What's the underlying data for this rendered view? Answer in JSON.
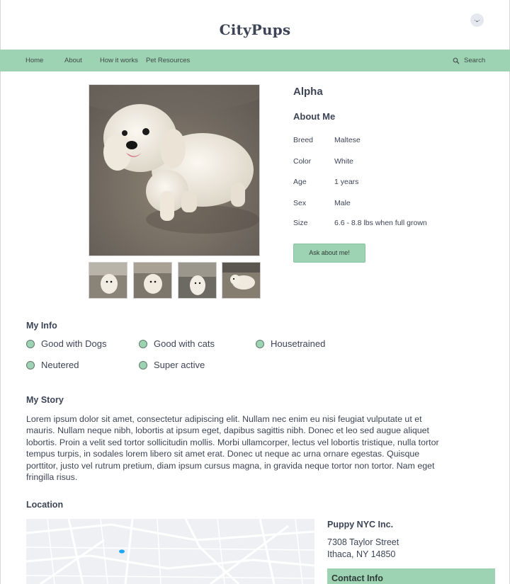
{
  "header": {
    "logo": "CityPups",
    "avatar_face": "·ᴗ·"
  },
  "nav": {
    "items": [
      {
        "label": "Home"
      },
      {
        "label": "About"
      },
      {
        "label": "How it works"
      },
      {
        "label": "Pet Resources"
      }
    ],
    "search_label": "Search",
    "search_icon": "search-icon"
  },
  "dog": {
    "name": "Alpha",
    "about_title": "About Me",
    "attributes": [
      {
        "label": "Breed",
        "value": "Maltese"
      },
      {
        "label": "Color",
        "value": "White"
      },
      {
        "label": "Age",
        "value": "1 years"
      },
      {
        "label": "Sex",
        "value": "Male"
      },
      {
        "label": "Size",
        "value": "6.6 - 8.8 lbs when full grown"
      }
    ],
    "ask_button": "Ask about me!"
  },
  "my_info": {
    "title": "My Info",
    "traits": [
      "Good with Dogs",
      "Good with cats",
      "Housetrained",
      "Neutered",
      "Super active"
    ]
  },
  "my_story": {
    "title": "My Story",
    "text": "Lorem ipsum dolor sit amet, consectetur adipiscing elit. Nullam nec enim eu nisi feugiat vulputate ut et mauris. Nullam neque nibh, lobortis at ipsum eget, dapibus sagittis nibh. Donec et leo sed augue aliquet lobortis. Proin a velit sed tortor sollicitudin mollis. Morbi ullamcorper, lectus vel lobortis tristique, nulla tortor tempus turpis, in sodales lorem libero sit amet erat. Donec ut neque ac urna ornare egestas. Quisque porttitor, justo vel rutrum pretium, diam ipsum cursus magna, in gravida neque tortor non tortor. Nam eget fringilla risus."
  },
  "location": {
    "title": "Location",
    "org_name": "Puppy NYC Inc.",
    "address_line1": "7308 Taylor Street",
    "address_line2": "Ithaca, NY 14850",
    "contact_title": "Contact Info"
  },
  "colors": {
    "accent": "#9dd2b3",
    "text": "#3c4456",
    "map_pin": "#1ea7f0"
  }
}
